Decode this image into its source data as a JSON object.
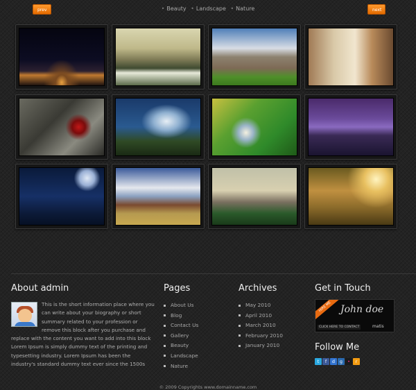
{
  "nav": {
    "prev_label": "prev",
    "next_label": "next"
  },
  "categories": [
    "Beauty",
    "Landscape",
    "Nature"
  ],
  "gallery": [
    {
      "name": "city-night-photo"
    },
    {
      "name": "coast-photo"
    },
    {
      "name": "college-building-photo"
    },
    {
      "name": "interior-room-photo"
    },
    {
      "name": "red-flower-photo"
    },
    {
      "name": "sky-river-photo"
    },
    {
      "name": "child-bokeh-photo"
    },
    {
      "name": "purple-lake-photo"
    },
    {
      "name": "moon-bird-photo"
    },
    {
      "name": "barn-photo"
    },
    {
      "name": "city-dome-photo"
    },
    {
      "name": "forest-sunlight-photo"
    }
  ],
  "about": {
    "title": "About admin",
    "text": "This is the short information place where you can write about your biography or short summary related to your profession or remove this block after you purchase and replace with the content you want to add into this block Lorem Ipsum is simply dummy text of the printing and typesetting industry. Lorem Ipsum has been the industry's standard dummy text ever since the 1500s"
  },
  "pages": {
    "title": "Pages",
    "items": [
      "About Us",
      "Blog",
      "Contact Us",
      "Gallery",
      "Beauty",
      "Landscape",
      "Nature"
    ]
  },
  "archives": {
    "title": "Archives",
    "items": [
      "May 2010",
      "April 2010",
      "March 2010",
      "February 2010",
      "January 2010"
    ]
  },
  "contact": {
    "title": "Get in Touch",
    "hire_label": "HIRE ME",
    "name": "John doe",
    "cta": "CLICK HERE TO CONTACT",
    "brand": "matis"
  },
  "follow": {
    "title": "Follow Me",
    "icons": [
      {
        "name": "twitter-icon",
        "glyph": "t",
        "color": "#2aa8e0"
      },
      {
        "name": "facebook-icon",
        "glyph": "f",
        "color": "#3b5998"
      },
      {
        "name": "delicious-icon",
        "glyph": "d",
        "color": "#3274d1"
      },
      {
        "name": "digg-icon",
        "glyph": "g",
        "color": "#2a6ab0"
      },
      {
        "name": "flickr-icon",
        "glyph": "•",
        "color": "#1a1a1a"
      },
      {
        "name": "rss-icon",
        "glyph": "r",
        "color": "#f39c12"
      }
    ]
  },
  "footer": {
    "copyright": "© 2009 Copyrights www.domainname.com"
  }
}
